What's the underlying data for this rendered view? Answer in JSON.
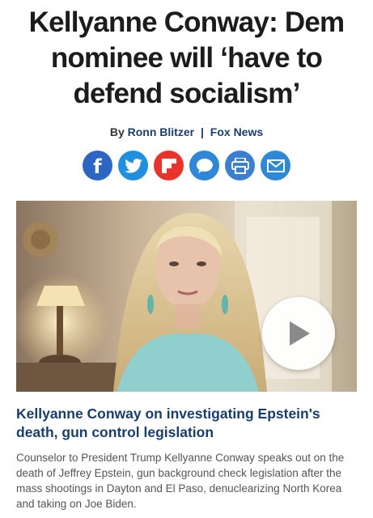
{
  "article": {
    "headline": "Kellyanne Conway: Dem nominee will ‘have to defend socialism’",
    "by_prefix": "By",
    "author": "Ronn Blitzer",
    "separator": "|",
    "source": "Fox News"
  },
  "share": {
    "buttons": [
      {
        "name": "facebook",
        "icon": "facebook-icon",
        "glyph": "f",
        "color": "#2d66c2"
      },
      {
        "name": "twitter",
        "icon": "twitter-icon",
        "color": "#1f8fe0"
      },
      {
        "name": "flipboard",
        "icon": "flipboard-icon",
        "color": "#e8322a"
      },
      {
        "name": "comment",
        "icon": "comment-icon",
        "color": "#2f87d8"
      },
      {
        "name": "print",
        "icon": "print-icon",
        "color": "#3a7fd0"
      },
      {
        "name": "email",
        "icon": "email-icon",
        "color": "#2f87d8"
      }
    ]
  },
  "video": {
    "thumbnail": "video-thumbnail",
    "play_icon": "play-icon",
    "title": "Kellyanne Conway on investigating Epstein's death, gun control legislation",
    "description": "Counselor to President Trump Kellyanne Conway speaks out on the death of Jeffrey Epstein, gun background check legislation after the mass shootings in Dayton and El Paso, denuclearizing North Korea and taking on Joe Biden."
  }
}
